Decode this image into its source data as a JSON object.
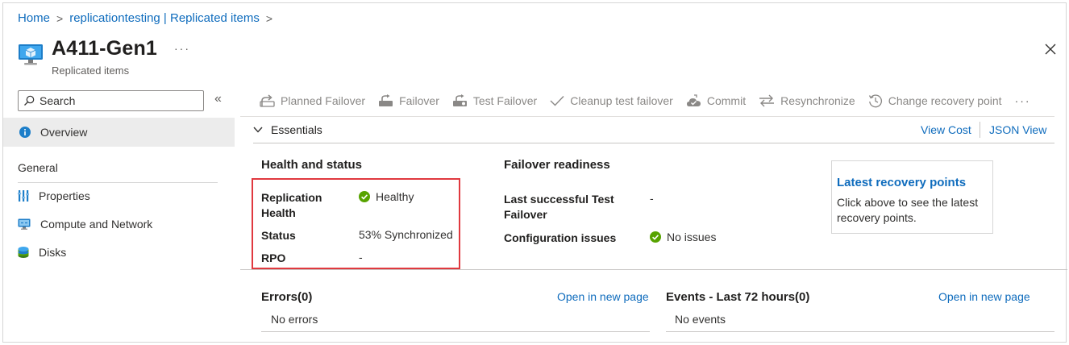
{
  "breadcrumb": {
    "items": [
      "Home",
      "replicationtesting | Replicated items"
    ],
    "separator": ">"
  },
  "header": {
    "title": "A411-Gen1",
    "subtitle": "Replicated items",
    "more": "···"
  },
  "nav": {
    "search_placeholder": "Search",
    "collapse_glyph": "«",
    "overview": "Overview",
    "group_general": "General",
    "items": [
      {
        "label": "Properties",
        "icon": "properties-icon"
      },
      {
        "label": "Compute and Network",
        "icon": "compute-network-icon"
      },
      {
        "label": "Disks",
        "icon": "disks-icon"
      }
    ]
  },
  "toolbar": {
    "items": [
      {
        "label": "Planned Failover",
        "icon": "planned-failover-icon"
      },
      {
        "label": "Failover",
        "icon": "failover-icon"
      },
      {
        "label": "Test Failover",
        "icon": "test-failover-icon"
      },
      {
        "label": "Cleanup test failover",
        "icon": "check-icon"
      },
      {
        "label": "Commit",
        "icon": "commit-icon"
      },
      {
        "label": "Resynchronize",
        "icon": "resynchronize-icon"
      },
      {
        "label": "Change recovery point",
        "icon": "history-icon"
      }
    ],
    "more": "···"
  },
  "essentials": {
    "label": "Essentials",
    "view_cost": "View Cost",
    "json_view": "JSON View"
  },
  "health": {
    "heading": "Health and status",
    "replication_health_label": "Replication Health",
    "replication_health_value": "Healthy",
    "status_label": "Status",
    "status_value": "53% Synchronized",
    "rpo_label": "RPO",
    "rpo_value": "-"
  },
  "failover": {
    "heading": "Failover readiness",
    "last_test_label": "Last successful Test Failover",
    "last_test_value": "-",
    "config_label": "Configuration issues",
    "config_value": "No issues"
  },
  "recovery": {
    "title": "Latest recovery points",
    "text": "Click above to see the latest recovery points."
  },
  "errors": {
    "heading": "Errors(0)",
    "open_link": "Open in new page",
    "empty": "No errors"
  },
  "events": {
    "heading": "Events - Last 72 hours(0)",
    "open_link": "Open in new page",
    "empty": "No events"
  },
  "colors": {
    "accent": "#0f6cbd",
    "success": "#57a300",
    "highlight_box": "#e0393f"
  }
}
